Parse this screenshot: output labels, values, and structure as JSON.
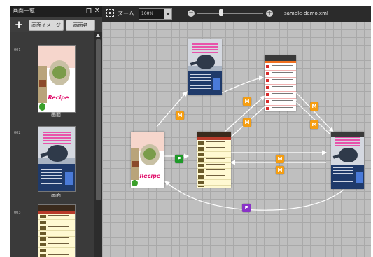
{
  "left_panel": {
    "title": "画面一覧",
    "add_icon": "plus-icon",
    "buttons": {
      "image": "画面イメージ",
      "name": "画面名"
    },
    "items": [
      {
        "number": "001",
        "label": "画面"
      },
      {
        "number": "002",
        "label": "画面"
      },
      {
        "number": "003",
        "label": ""
      }
    ]
  },
  "toolbar": {
    "zoom_label": "ズーム",
    "zoom_value": "100%",
    "filename": "sample-demo.xml",
    "zoom_level": 0.36
  },
  "canvas": {
    "badges": {
      "m": "M",
      "p": "P",
      "f": "F"
    }
  },
  "colors": {
    "transition_m": "#f59e12",
    "transition_p": "#1e9a28",
    "transition_f": "#8a32c8",
    "edge": "#ffffff"
  }
}
